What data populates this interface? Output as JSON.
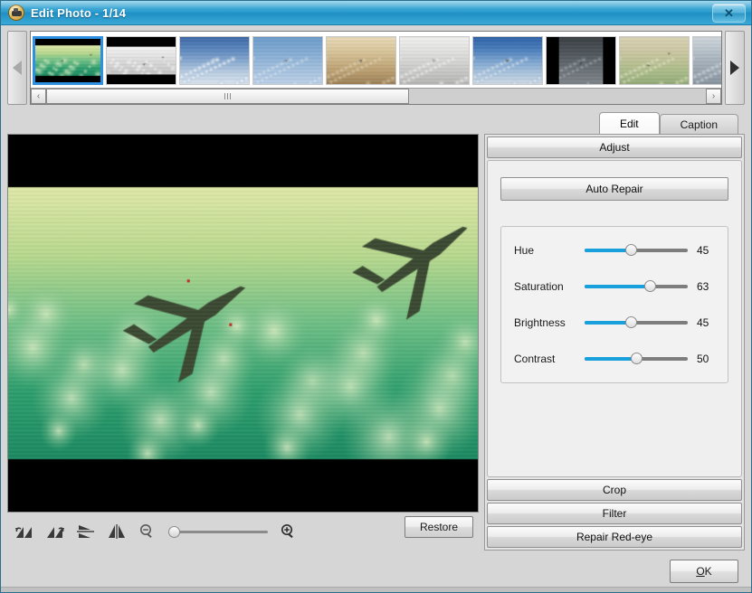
{
  "window": {
    "title": "Edit Photo - 1/14",
    "icon": "photo-app-icon",
    "close_label": "✕"
  },
  "thumbnail_strip": {
    "prev_arrow": "◀",
    "next_arrow": "▶",
    "scroll_left": "‹",
    "scroll_right": "›",
    "selected_index": 0,
    "count": 14,
    "items": [
      {
        "name": "thumb-1-jet-green",
        "selected": true
      },
      {
        "name": "thumb-2-jets-bw",
        "selected": false
      },
      {
        "name": "thumb-3-airliner",
        "selected": false
      },
      {
        "name": "thumb-4-fighter-blue",
        "selected": false
      },
      {
        "name": "thumb-5-jet-desert",
        "selected": false
      },
      {
        "name": "thumb-6-bomber-grey",
        "selected": false
      },
      {
        "name": "thumb-7-jet-mountains",
        "selected": false
      },
      {
        "name": "thumb-8-jet-dark",
        "selected": false
      },
      {
        "name": "thumb-9-prop-plane",
        "selected": false
      },
      {
        "name": "thumb-10-jet-red",
        "selected": false
      }
    ]
  },
  "tabs": [
    {
      "label": "Edit",
      "active": true
    },
    {
      "label": "Caption",
      "active": false
    }
  ],
  "preview": {
    "name": "photo-preview",
    "description": "Green tinted fighter jets in flight"
  },
  "toolbar": {
    "rotate_left": "rotate-left-icon",
    "rotate_right": "rotate-right-icon",
    "flip_vertical": "flip-vertical-icon",
    "flip_horizontal": "flip-horizontal-icon",
    "zoom_out": "zoom-out-icon",
    "zoom_in": "zoom-in-icon",
    "zoom_value": 0,
    "restore_label": "Restore"
  },
  "panel": {
    "adjust": {
      "header": "Adjust",
      "auto_repair_label": "Auto Repair",
      "sliders": [
        {
          "label": "Hue",
          "value": 45,
          "min": 0,
          "max": 100
        },
        {
          "label": "Saturation",
          "value": 63,
          "min": 0,
          "max": 100
        },
        {
          "label": "Brightness",
          "value": 45,
          "min": 0,
          "max": 100
        },
        {
          "label": "Contrast",
          "value": 50,
          "min": 0,
          "max": 100
        }
      ]
    },
    "sections": [
      {
        "header": "Crop"
      },
      {
        "header": "Filter"
      },
      {
        "header": "Repair Red-eye"
      }
    ]
  },
  "footer": {
    "ok_label": "OK",
    "ok_accel": "O"
  },
  "colors": {
    "title_bar": "#2e9fd0",
    "accent": "#18a0dd",
    "selection": "#2f8fe0",
    "window_bg": "#d6d6d6"
  }
}
